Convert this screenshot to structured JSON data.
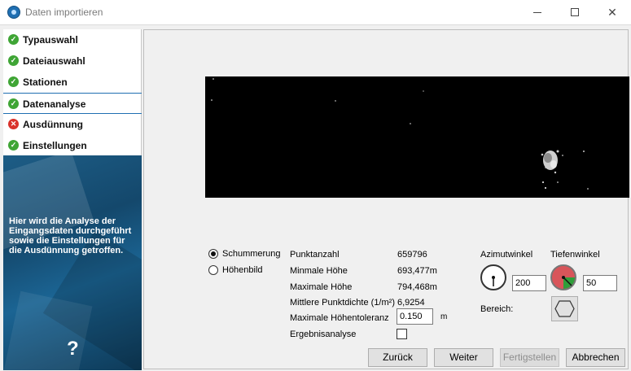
{
  "window": {
    "title": "Daten importieren",
    "controls": {
      "minimize": "",
      "maximize": "",
      "close": "✕"
    }
  },
  "nav": {
    "items": [
      {
        "label": "Typauswahl",
        "status": "ok",
        "active": false
      },
      {
        "label": "Dateiauswahl",
        "status": "ok",
        "active": false
      },
      {
        "label": "Stationen",
        "status": "ok",
        "active": false
      },
      {
        "label": "Datenanalyse",
        "status": "ok",
        "active": true
      },
      {
        "label": "Ausdünnung",
        "status": "error",
        "active": false
      },
      {
        "label": "Einstellungen",
        "status": "ok",
        "active": false
      }
    ],
    "status_icons": {
      "ok": "✓",
      "error": "✕"
    }
  },
  "info": {
    "text": "Hier wird die Analyse der Eingangsdaten durchgeführt sowie die Einstellungen für die Ausdünnung getroffen.",
    "help_icon": "?"
  },
  "view_mode": {
    "options": [
      {
        "label": "Schummerung",
        "checked": true
      },
      {
        "label": "Höhenbild",
        "checked": false
      }
    ]
  },
  "stats": {
    "punktanzahl_label": "Punktanzahl",
    "punktanzahl_value": "659796",
    "min_hoehe_label": "Minmale Höhe",
    "min_hoehe_value": "693,477m",
    "max_hoehe_label": "Maximale Höhe",
    "max_hoehe_value": "794,468m",
    "punktdichte_label": "Mittlere Punktdichte (1/m²)",
    "punktdichte_value": "6,9254",
    "toleranz_label": "Maximale Höhentoleranz",
    "toleranz_value": "0.150",
    "toleranz_unit": "m",
    "ergebnis_label": "Ergebnisanalyse",
    "ergebnis_checked": false
  },
  "angles": {
    "azimut_label": "Azimutwinkel",
    "azimut_value": "200",
    "tiefen_label": "Tiefenwinkel",
    "tiefen_value": "50",
    "bereich_label": "Bereich:"
  },
  "buttons": {
    "back": "Zurück",
    "next": "Weiter",
    "finish": "Fertigstellen",
    "cancel": "Abbrechen"
  },
  "colors": {
    "ok": "#3fa535",
    "error": "#d9322b",
    "accent": "#1f6fb2",
    "tiefen_dial": "#d8555a",
    "tiefen_sector": "#2e9e3a"
  }
}
